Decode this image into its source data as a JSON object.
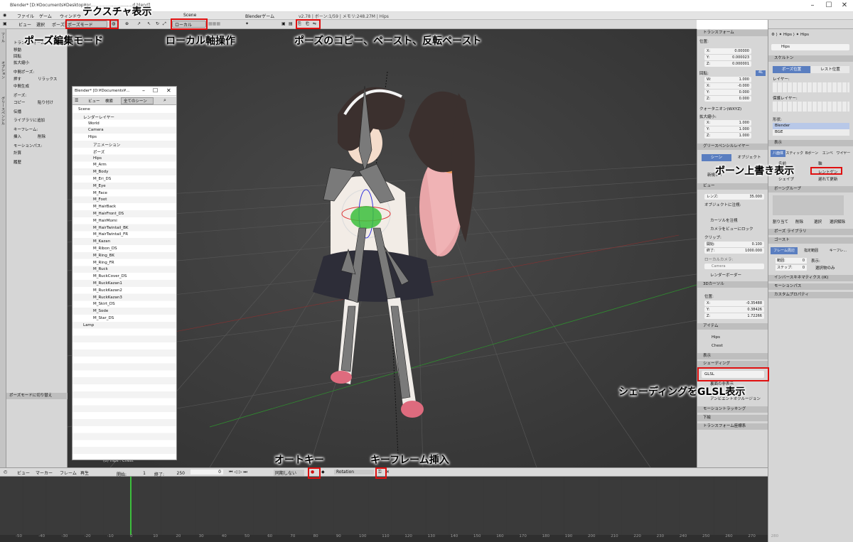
{
  "titlebar": {
    "title": "Blender* [D:¥Documents¥Desktop¥pr...............................d.blend]"
  },
  "infobar": {
    "menus": [
      "ファイル",
      "ゲーム",
      "ウィンドウ"
    ],
    "scene": "Scene",
    "engine": "Blenderゲーム",
    "stats": "v2.78 | ボーン:1/59 | メモリ:248.27M | Hips"
  },
  "view3d_header": {
    "menus": [
      "ビュー",
      "選択",
      "ポーズ"
    ],
    "mode": "ポーズモード",
    "orientation": "ローカル"
  },
  "toolshelf": {
    "tabs": [
      "ツール",
      "オプション",
      "グリースペンシル"
    ],
    "items": [
      "トランスフォーム",
      "移動",
      "回転",
      "拡大縮小",
      "中間ポーズ:",
      "押す",
      "リラックス",
      "中間生成",
      "ポーズ:",
      "コピー",
      "貼り付け",
      "伝播",
      "ライブラリに追加",
      "キーフレーム:",
      "挿入",
      "削除",
      "モーションパス:",
      "計算",
      "履歴"
    ],
    "operator_panel": "ポーズモードに切り替え"
  },
  "outliner": {
    "title": "Blender* [D:¥Documents¥...",
    "header": [
      "ビュー",
      "検索",
      "全てのシーン"
    ],
    "items": [
      "Scene",
      "レンダーレイヤー",
      "World",
      "Camera",
      "Hips",
      "アニメーション",
      "ポーズ",
      "Hips",
      "M_Arm",
      "M_Body",
      "M_Eri_DS",
      "M_Eye",
      "M_Face",
      "M_Foot",
      "M_HairBack",
      "M_HairFront_DS",
      "M_HairMomi",
      "M_HairTwintail_BK",
      "M_HairTwintail_FR",
      "M_Kazan",
      "M_Ribon_DS",
      "M_Ring_BK",
      "M_Ring_FR",
      "M_Ruck",
      "M_RuckCover_DS",
      "M_RuckKazan1",
      "M_RuckKazan2",
      "M_RuckKazan3",
      "M_Skirt_DS",
      "M_Sode",
      "M_Star_DS",
      "Lamp"
    ]
  },
  "viewport": {
    "status": "(0) Hips : Chest"
  },
  "npanel": {
    "transform": {
      "title": "トランスフォーム",
      "location_label": "位置:",
      "location": [
        {
          "axis": "X:",
          "value": "0.00000"
        },
        {
          "axis": "Y:",
          "value": "0.000023"
        },
        {
          "axis": "Z:",
          "value": "0.000001"
        }
      ],
      "rotation_label": "回転:",
      "rotation": [
        {
          "axis": "W:",
          "value": "1.000"
        },
        {
          "axis": "X:",
          "value": "-0.000"
        },
        {
          "axis": "Y:",
          "value": "0.000"
        },
        {
          "axis": "Z:",
          "value": "0.000"
        }
      ],
      "rotation_mode": "クォータニオン(WXYZ)",
      "scale_label": "拡大縮小:",
      "scale": [
        {
          "axis": "X:",
          "value": "1.000"
        },
        {
          "axis": "Y:",
          "value": "1.000"
        },
        {
          "axis": "Z:",
          "value": "1.000"
        }
      ],
      "badge": "4L"
    },
    "grease": {
      "title": "グリースペンシルレイヤー",
      "tabs": [
        "シーン",
        "オブジェクト"
      ],
      "new_layer": "新規レイ"
    },
    "view": {
      "title": "ビュー",
      "lens_label": "レンズ:",
      "lens": "35.000",
      "lock_label": "オブジェクトに注視:",
      "cursor_lock": "カーソルを注視",
      "camera_lock": "カメラをビューにロック",
      "clip_label": "クリップ:",
      "clip_start_label": "開始:",
      "clip_start": "0.100",
      "clip_end_label": "終了:",
      "clip_end": "1000.000",
      "local_camera": "ローカルカメラ:",
      "camera": "Camera",
      "render_border": "レンダーボーダー"
    },
    "cursor": {
      "title": "3Dカーソル",
      "location_label": "位置:",
      "location": [
        {
          "axis": "X:",
          "value": "-0.35488"
        },
        {
          "axis": "Y:",
          "value": "0.38426"
        },
        {
          "axis": "Z:",
          "value": "1.72266"
        }
      ]
    },
    "item": {
      "title": "アイテム",
      "bone": "Hips",
      "bone2": "Chest"
    },
    "display": {
      "title": "表示"
    },
    "shading": {
      "title": "シェーディング",
      "mode": "GLSL",
      "backface": "裏面の非表示",
      "ao": "アンビエントオクルージョン"
    },
    "motion_tracking": "モーショントラッキング",
    "background": "下絵",
    "transform_orient": "トランスフォーム座標系"
  },
  "properties": {
    "breadcrumb": [
      "Hips",
      "Hips"
    ],
    "name": "Hips",
    "skeleton": {
      "title": "スケルトン",
      "pose_pos": "ポーズ位置",
      "rest_pos": "レスト位置",
      "layers": "レイヤー:",
      "protected": "保護レイヤー:",
      "shape": "形状:",
      "shape_opts": [
        "Blender",
        "BGE"
      ]
    },
    "display": {
      "title": "表示",
      "shape_opts": [
        "八面体",
        "スティック",
        "Bボーン",
        "エンベ",
        "ワイヤー"
      ],
      "names": "名前",
      "axes": "軸",
      "shapes": "シェイプ",
      "xray": "レントゲン",
      "delay": "遅れて更新"
    },
    "bone_groups": {
      "title": "ボーングループ",
      "assign": "割り当て",
      "remove": "削除",
      "select": "選択",
      "deselect": "選択解除"
    },
    "pose_lib": "ポーズ ライブラリ",
    "ghost": {
      "title": "ゴースト",
      "tabs": [
        "フレーム周辺",
        "指定範囲",
        "キーフレ..."
      ],
      "range_label": "範囲:",
      "range": "0",
      "step_label": "ステップ:",
      "step": "0",
      "display": "表示:",
      "selected_only": "選択物のみ"
    },
    "ik": "インバースキネマティクス (iK)",
    "motion_path": "モーションパス",
    "custom_props": "カスタムプロパティ"
  },
  "timeline": {
    "menus": [
      "ビュー",
      "マーカー",
      "フレーム",
      "再生"
    ],
    "start_label": "開始:",
    "start": "1",
    "end_label": "終了:",
    "end": "250",
    "current": "0",
    "sync": "同期しない",
    "keying_set": "Rotation",
    "ticks": [
      "-50",
      "-40",
      "-30",
      "-20",
      "-10",
      "0",
      "10",
      "20",
      "30",
      "40",
      "50",
      "60",
      "70",
      "80",
      "90",
      "100",
      "110",
      "120",
      "130",
      "140",
      "150",
      "160",
      "170",
      "180",
      "190",
      "200",
      "210",
      "220",
      "230",
      "240",
      "250",
      "260",
      "270",
      "280"
    ]
  },
  "annotations": {
    "texture": "テクスチャ表示",
    "pose_mode": "ポーズ編集モード",
    "local_axis": "ローカル軸操作",
    "copy_paste": "ポーズのコピー、ペースト、反転ペースト",
    "bone_overlay": "ボーン上書き表示",
    "glsl": "シェーディングをGLSL表示",
    "autokey": "オートキー",
    "insert_key": "キーフレーム挿入"
  },
  "colors": {
    "callout_box": "#e01010",
    "viewport_bg": "#3d3d3d",
    "timeline_bg": "#3a3a3a",
    "current_frame": "#3cbf3c"
  }
}
